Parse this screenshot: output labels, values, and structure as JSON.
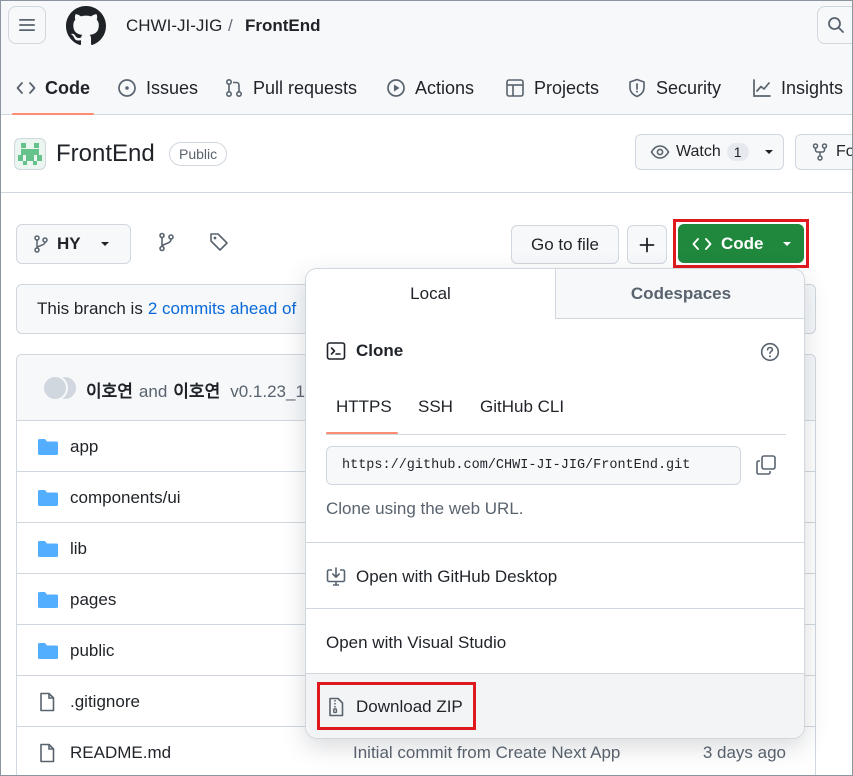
{
  "breadcrumb": {
    "owner": "CHWI-JI-JIG",
    "separator": "/",
    "repo": "FrontEnd"
  },
  "nav_tabs": [
    {
      "label": "Code",
      "icon": "code-icon",
      "active": true
    },
    {
      "label": "Issues",
      "icon": "issue-opened-icon"
    },
    {
      "label": "Pull requests",
      "icon": "git-pull-request-icon"
    },
    {
      "label": "Actions",
      "icon": "play-icon"
    },
    {
      "label": "Projects",
      "icon": "table-icon"
    },
    {
      "label": "Security",
      "icon": "shield-icon"
    },
    {
      "label": "Insights",
      "icon": "graph-icon"
    }
  ],
  "repo": {
    "name": "FrontEnd",
    "visibility": "Public",
    "watch_label": "Watch",
    "watch_count": "1",
    "fork_label": "Fo"
  },
  "toolbar": {
    "branch": "HY",
    "goto_file": "Go to file",
    "code_label": "Code"
  },
  "branch_banner": {
    "prefix": "This branch is",
    "link": "2 commits ahead of"
  },
  "commit": {
    "author1": "이호연",
    "conjunction": "and",
    "author2": "이호연",
    "message": "v0.1.23_1"
  },
  "files": [
    {
      "type": "folder",
      "name": "app",
      "message": "",
      "time": ""
    },
    {
      "type": "folder",
      "name": "components/ui",
      "message": "",
      "time": ""
    },
    {
      "type": "folder",
      "name": "lib",
      "message": "",
      "time": ""
    },
    {
      "type": "folder",
      "name": "pages",
      "message": "",
      "time": ""
    },
    {
      "type": "folder",
      "name": "public",
      "message": "",
      "time": ""
    },
    {
      "type": "file",
      "name": ".gitignore",
      "message": "",
      "time": ""
    },
    {
      "type": "file",
      "name": "README.md",
      "message": "Initial commit from Create Next App",
      "time": "3 days ago"
    }
  ],
  "code_dropdown": {
    "tabs": {
      "local": "Local",
      "codespaces": "Codespaces"
    },
    "clone_title": "Clone",
    "protocols": [
      "HTTPS",
      "SSH",
      "GitHub CLI"
    ],
    "active_protocol": "HTTPS",
    "clone_url": "https://github.com/CHWI-JI-JIG/FrontEnd.git",
    "clone_note": "Clone using the web URL.",
    "open_desktop": "Open with GitHub Desktop",
    "open_vs": "Open with Visual Studio",
    "download_zip": "Download ZIP"
  },
  "colors": {
    "accent_green": "#1f883d",
    "link_blue": "#0969da",
    "highlight_red": "#e0191f",
    "tab_underline": "#fd8c73"
  }
}
